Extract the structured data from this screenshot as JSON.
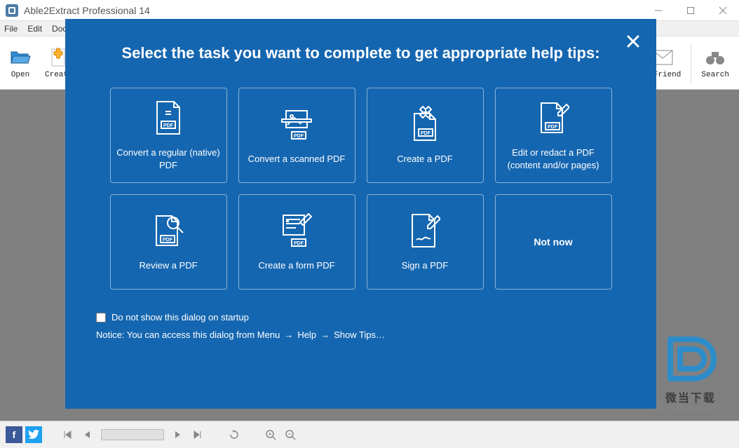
{
  "window": {
    "title": "Able2Extract Professional 14"
  },
  "menu": {
    "file": "File",
    "edit": "Edit",
    "document": "Docu…"
  },
  "toolbar": {
    "open": "Open",
    "create": "Create",
    "friend": "A Friend",
    "search": "Search"
  },
  "modal": {
    "heading": "Select the task you want to complete to get appropriate help tips:",
    "tiles": [
      {
        "label": "Convert a regular (native) PDF"
      },
      {
        "label": "Convert a scanned PDF"
      },
      {
        "label": "Create a PDF"
      },
      {
        "label": "Edit or redact a PDF (content and/or pages)"
      },
      {
        "label": "Review a PDF"
      },
      {
        "label": "Create a form PDF"
      },
      {
        "label": "Sign a PDF"
      },
      {
        "label": "Not now"
      }
    ],
    "dontshow_label": "Do not show this dialog on startup",
    "notice_prefix": "Notice: You can access this dialog from Menu",
    "notice_help": "Help",
    "notice_showtips": "Show Tips…"
  },
  "watermark": {
    "line1": "微当下载",
    "line2": "WWW.WEIDOWN.COM"
  },
  "social": {
    "fb": "f",
    "tw": "t"
  }
}
